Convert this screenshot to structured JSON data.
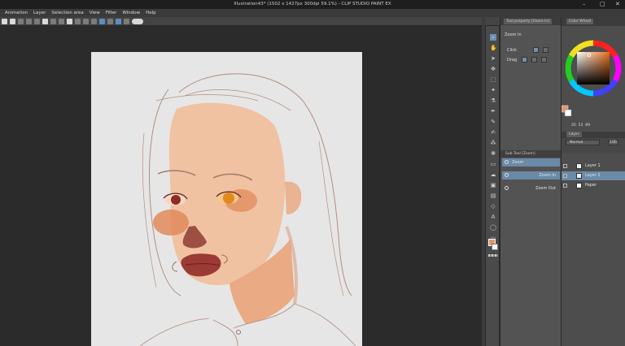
{
  "window": {
    "title": "Illustration43* (1502 x 1427px 300dpi 59.1%)  - CLIP STUDIO PAINT EX",
    "minimize": "–",
    "maximize": "□",
    "close": "✕"
  },
  "menu": [
    "Animation",
    "Layer",
    "Selection area",
    "View",
    "Filter",
    "Window",
    "Help"
  ],
  "tool_property": {
    "tab_label": "Tool property [Zoom In]",
    "title": "Zoom In",
    "click_label": "Click",
    "drag_label": "Drag"
  },
  "sub_tool": {
    "tab_label": "Sub Tool [Zoom]",
    "items": [
      "Zoom",
      "Zoom In",
      "Zoom Out"
    ]
  },
  "color_wheel": {
    "tab_label": "Color Wheel",
    "h_value": "20",
    "s_value": "53",
    "v_value": "89",
    "main_color": "#e8956a",
    "sub_color": "#ffffff"
  },
  "layers": {
    "tab_label": "Layer",
    "blend_mode": "Normal",
    "opacity": "100",
    "items": [
      {
        "name": "Layer 1",
        "selected": false
      },
      {
        "name": "Layer 2",
        "selected": true
      },
      {
        "name": "Paper",
        "selected": false
      }
    ]
  },
  "colors": {
    "skin": "#f0c2a2",
    "blush": "#e08a5a",
    "lips": "#9c3a36",
    "line": "#9b6a52",
    "selection": "#6a8aa8"
  }
}
